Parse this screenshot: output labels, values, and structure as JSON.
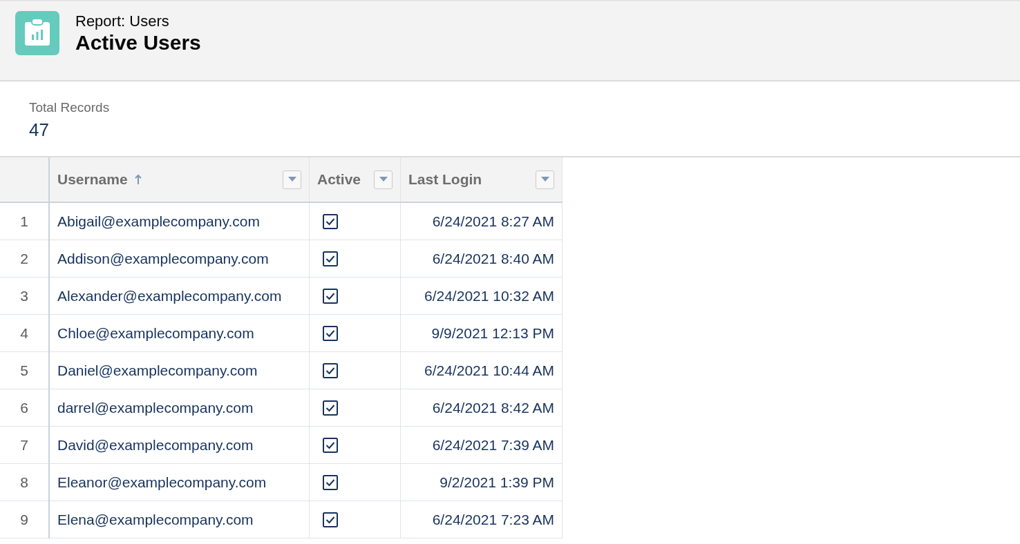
{
  "header": {
    "subtitle": "Report: Users",
    "title": "Active Users"
  },
  "summary": {
    "label": "Total Records",
    "value": "47"
  },
  "table": {
    "columns": [
      {
        "label": "Username",
        "sorted_ascending": true
      },
      {
        "label": "Active",
        "sorted_ascending": false
      },
      {
        "label": "Last Login",
        "sorted_ascending": false
      }
    ],
    "rows": [
      {
        "number": "1",
        "username": "Abigail@examplecompany.com",
        "active": true,
        "last_login": "6/24/2021 8:27 AM"
      },
      {
        "number": "2",
        "username": "Addison@examplecompany.com",
        "active": true,
        "last_login": "6/24/2021 8:40 AM"
      },
      {
        "number": "3",
        "username": "Alexander@examplecompany.com",
        "active": true,
        "last_login": "6/24/2021 10:32 AM"
      },
      {
        "number": "4",
        "username": "Chloe@examplecompany.com",
        "active": true,
        "last_login": "9/9/2021 12:13 PM"
      },
      {
        "number": "5",
        "username": "Daniel@examplecompany.com",
        "active": true,
        "last_login": "6/24/2021 10:44 AM"
      },
      {
        "number": "6",
        "username": "darrel@examplecompany.com",
        "active": true,
        "last_login": "6/24/2021 8:42 AM"
      },
      {
        "number": "7",
        "username": "David@examplecompany.com",
        "active": true,
        "last_login": "6/24/2021 7:39 AM"
      },
      {
        "number": "8",
        "username": "Eleanor@examplecompany.com",
        "active": true,
        "last_login": "9/2/2021 1:39 PM"
      },
      {
        "number": "9",
        "username": "Elena@examplecompany.com",
        "active": true,
        "last_login": "6/24/2021 7:23 AM"
      }
    ]
  }
}
